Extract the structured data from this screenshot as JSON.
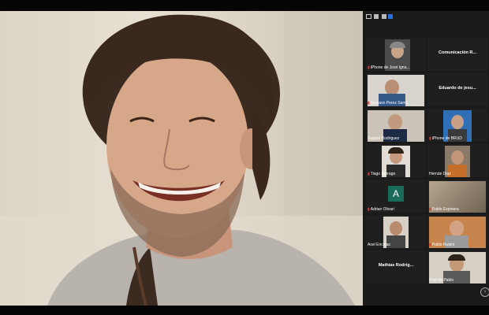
{
  "participants": [
    {
      "name": "iPhone de José Igna...",
      "style": "video"
    },
    {
      "name": "Comunicación R...",
      "style": "name-only"
    },
    {
      "name": "Gustavo Perez Sarmi...",
      "style": "video"
    },
    {
      "name": "Eduardo de jesu...",
      "style": "name-only"
    },
    {
      "name": "Gabriel Rodriguez",
      "style": "video"
    },
    {
      "name": "iPhone de BRUD",
      "style": "video"
    },
    {
      "name": "Tiago Serrago",
      "style": "video"
    },
    {
      "name": "Hernán Diaz",
      "style": "video"
    },
    {
      "name": "Adrian Olivari",
      "style": "avatar",
      "initial": "A"
    },
    {
      "name": "Pablo Espinera",
      "style": "video"
    },
    {
      "name": "Axel Encinas",
      "style": "video"
    },
    {
      "name": "Pablo Rubini",
      "style": "video"
    },
    {
      "name": "Mathias Rodrig...",
      "style": "name-only"
    },
    {
      "name": "iPad de Pablo",
      "style": "video"
    }
  ],
  "colors": {
    "panel": "#1a1a1a",
    "mic_muted": "#e53935",
    "avatar": "#1a6a5a"
  },
  "icons": [
    "speaker-view-icon",
    "grid-view-icon",
    "close-icon",
    "chevron-right-icon"
  ]
}
